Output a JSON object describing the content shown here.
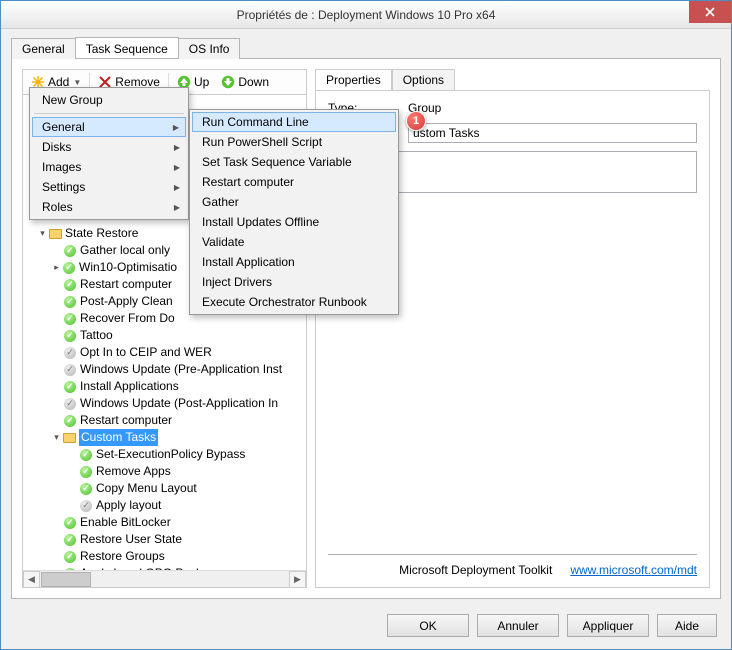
{
  "window": {
    "title": "Propriétés de : Deployment Windows 10 Pro x64"
  },
  "tabs": {
    "general": "General",
    "task_sequence": "Task Sequence",
    "os_info": "OS Info"
  },
  "toolbar": {
    "add": "Add",
    "remove": "Remove",
    "up": "Up",
    "down": "Down"
  },
  "menu_level1": {
    "new_group": "New Group",
    "general": "General",
    "disks": "Disks",
    "images": "Images",
    "settings": "Settings",
    "roles": "Roles"
  },
  "menu_level2": {
    "run_cmd": "Run Command Line",
    "run_ps": "Run PowerShell Script",
    "set_tsv": "Set Task Sequence Variable",
    "restart": "Restart computer",
    "gather": "Gather",
    "install_updates": "Install Updates Offline",
    "validate": "Validate",
    "install_app": "Install Application",
    "inject_drivers": "Inject Drivers",
    "exec_orch": "Execute Orchestrator Runbook"
  },
  "tree": {
    "state_restore": "State Restore",
    "gather_local": "Gather local only",
    "win10opt": "Win10-Optimisatio",
    "restart1": "Restart computer",
    "post_apply": "Post-Apply Clean",
    "recover_do": "Recover From Do",
    "tattoo": "Tattoo",
    "ceip": "Opt In to CEIP and WER",
    "wu_pre": "Windows Update (Pre-Application Inst",
    "install_apps": "Install Applications",
    "wu_post": "Windows Update (Post-Application In",
    "restart2": "Restart computer",
    "custom_tasks": "Custom Tasks",
    "set_exec": "Set-ExecutionPolicy Bypass",
    "remove_apps": "Remove Apps",
    "copy_menu": "Copy Menu Layout",
    "apply_layout": "Apply layout",
    "enable_bitlocker": "Enable BitLocker",
    "restore_user": "Restore User State",
    "restore_groups": "Restore Groups",
    "apply_gpo": "Apply Local GPO Package"
  },
  "properties": {
    "tab_props": "Properties",
    "tab_options": "Options",
    "type_label": "Type:",
    "type_value": "Group",
    "name_value": "ustom Tasks",
    "footer_text": "Microsoft Deployment Toolkit",
    "footer_link": "www.microsoft.com/mdt"
  },
  "buttons": {
    "ok": "OK",
    "cancel": "Annuler",
    "apply": "Appliquer",
    "help": "Aide"
  },
  "callout": {
    "n1": "1"
  }
}
